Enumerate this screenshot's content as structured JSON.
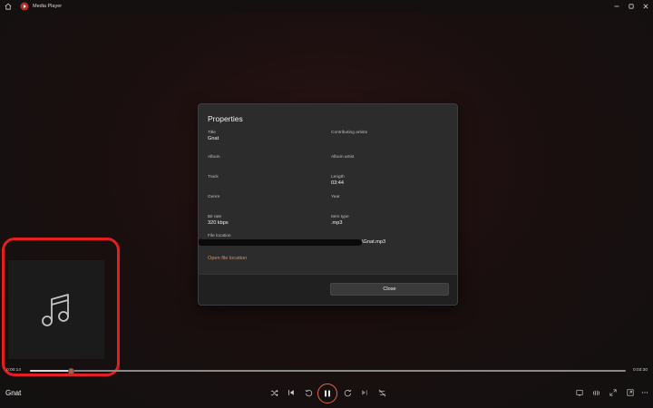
{
  "titlebar": {
    "app_title": "Media Player",
    "icons": [
      "home-icon",
      "media-player-logo-icon",
      "minimize-icon",
      "maximize-icon",
      "close-icon"
    ]
  },
  "dialog": {
    "title": "Properties",
    "fields": {
      "title": {
        "label": "Title",
        "value": "Gnat"
      },
      "contributing_artists": {
        "label": "Contributing artists",
        "value": ""
      },
      "album": {
        "label": "Album",
        "value": ""
      },
      "album_artist": {
        "label": "Album artist",
        "value": ""
      },
      "track": {
        "label": "Track",
        "value": ""
      },
      "length": {
        "label": "Length",
        "value": "03:44"
      },
      "genre": {
        "label": "Genre",
        "value": ""
      },
      "year": {
        "label": "Year",
        "value": ""
      },
      "bit_rate": {
        "label": "Bit rate",
        "value": "320 kbps"
      },
      "item_type": {
        "label": "Item type",
        "value": ".mp3"
      },
      "file_location": {
        "label": "File location",
        "value": "\\Gnat.mp3"
      }
    },
    "open_file_location_label": "Open file location",
    "close_label": "Close"
  },
  "album_art": {
    "icon": "music-note-icon"
  },
  "player": {
    "track_name": "Gnat",
    "elapsed": "0:00:14",
    "total": "0:03:30",
    "progress_fraction": 0.07,
    "accent_color": "#e06a4a",
    "controls": [
      "shuffle-icon",
      "previous-icon",
      "skip-back-10-icon",
      "pause-icon",
      "skip-forward-30-icon",
      "next-icon",
      "repeat-off-icon"
    ],
    "right_controls": [
      "miniplayer-icon",
      "cast-icon",
      "fullscreen-icon",
      "more-options-icon"
    ]
  },
  "highlight_color": "#e51f1f"
}
